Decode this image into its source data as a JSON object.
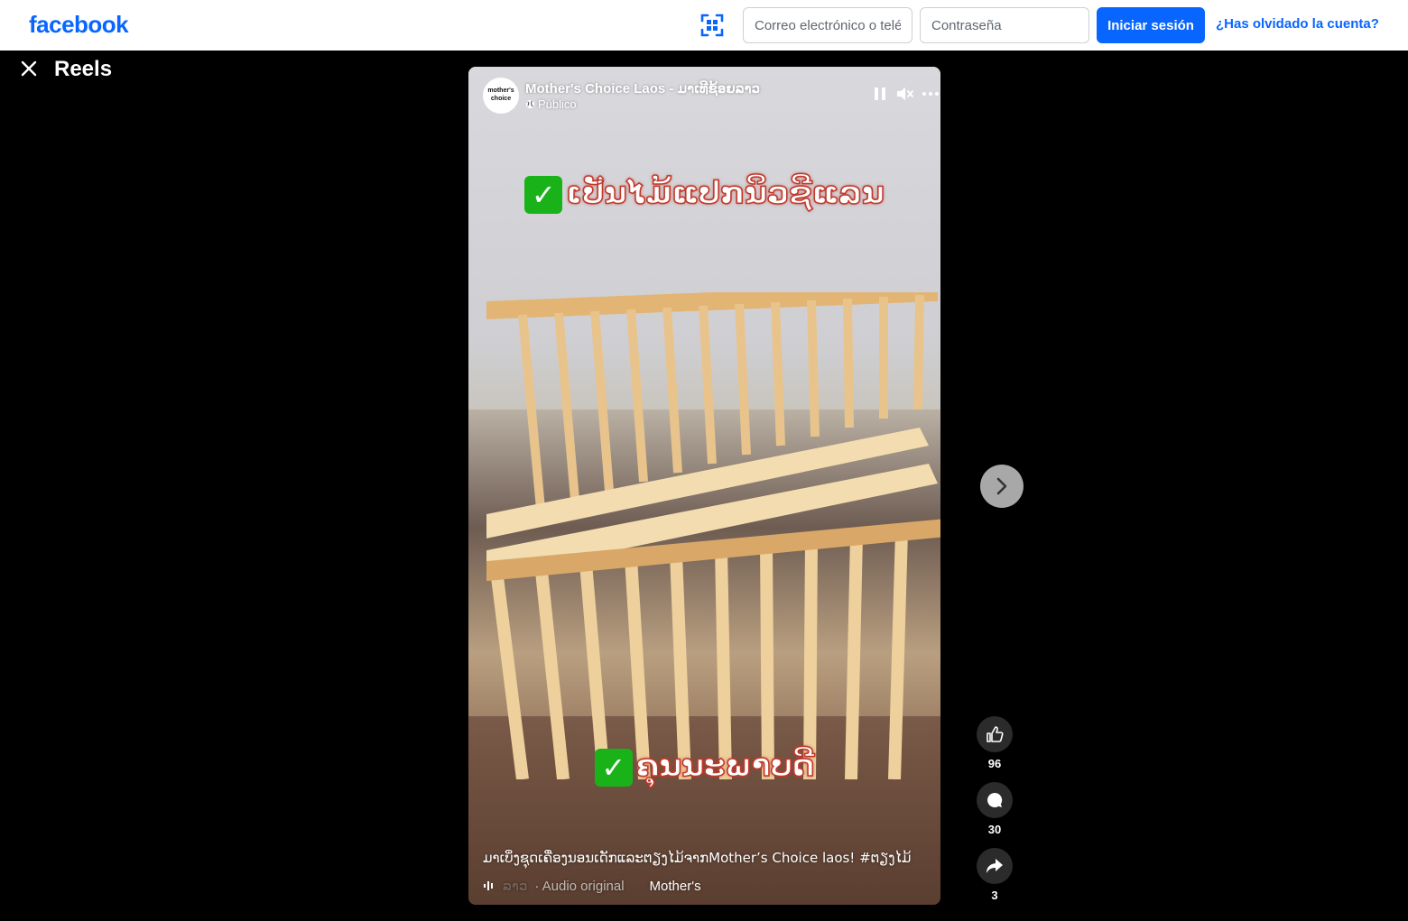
{
  "header": {
    "logo": "facebook",
    "email_placeholder": "Correo electrónico o teléfono",
    "password_placeholder": "Contraseña",
    "login_label": "Iniciar sesión",
    "forgot_label": "¿Has olvidado la cuenta?",
    "qr_icon": "qr-scan-icon"
  },
  "reels": {
    "title": "Reels",
    "close_icon": "close-icon"
  },
  "video": {
    "avatar_text": "mother's choice",
    "page_name": "Mother's Choice Laos - ມາເທີຊ້ອຍລາວ",
    "privacy": "Público",
    "overlay_top": "ເປັນໄມ້ແປກນິວຊີແລນ",
    "overlay_bottom": "ຄຸນນະພາບດີ",
    "caption": "ມາເບິ່ງຊຸດເຄື່ອງນອນເດັກແລະຕຽງໄມ້ຈາກMother’s Choice laos! #ຕຽງໄມ້",
    "audio_faded": "ລາວ",
    "audio_label": "· Audio original",
    "audio_page": "Mother's"
  },
  "actions": {
    "likes": "96",
    "comments": "30",
    "shares": "3"
  },
  "colors": {
    "brand": "#0866ff",
    "background": "#000000"
  }
}
